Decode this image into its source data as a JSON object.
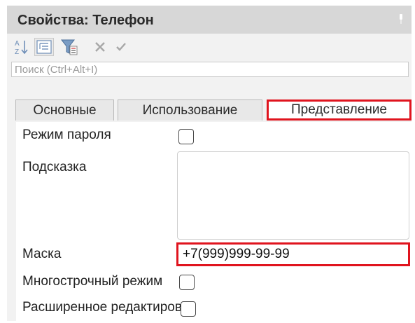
{
  "window": {
    "title": "Свойства: Телефон"
  },
  "toolbar": {
    "sort_icon": "sort-az-icon",
    "tree_icon": "hierarchy-icon",
    "filter_icon": "filter-icon",
    "close_icon": "close-icon",
    "check_icon": "checkmark-icon"
  },
  "search": {
    "placeholder": "Поиск (Ctrl+Alt+I)",
    "value": ""
  },
  "tabs": [
    {
      "label": "Основные",
      "active": false
    },
    {
      "label": "Использование",
      "active": false
    },
    {
      "label": "Представление",
      "active": true
    }
  ],
  "properties": {
    "password_mode": {
      "label": "Режим пароля",
      "checked": false
    },
    "hint": {
      "label": "Подсказка",
      "value": ""
    },
    "mask": {
      "label": "Маска",
      "value": "+7(999)999-99-99"
    },
    "multiline": {
      "label": "Многострочный режим",
      "checked": false
    },
    "extended_edit": {
      "label": "Расширенное редактирование",
      "checked": false
    }
  },
  "colors": {
    "highlight": "#e0141e",
    "titlebar": "#d7d7d7",
    "panel": "#f2f2f2"
  }
}
